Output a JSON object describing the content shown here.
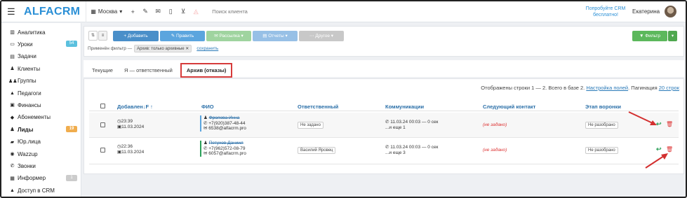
{
  "topbar": {
    "logo": "ALFACRM",
    "city": "Москва",
    "search_placeholder": "Поиск клиента",
    "promo": "Попробуйте CRM бесплатно!",
    "user": "Екатерина"
  },
  "sidebar": {
    "items": [
      {
        "label": "Аналитика",
        "icon": "chart-icon",
        "badge": ""
      },
      {
        "label": "Уроки",
        "icon": "lessons-icon",
        "badge": "54"
      },
      {
        "label": "Задачи",
        "icon": "tasks-icon",
        "badge": ""
      },
      {
        "label": "Клиенты",
        "icon": "user-icon",
        "badge": ""
      },
      {
        "label": "Группы",
        "icon": "users-icon",
        "badge": ""
      },
      {
        "label": "Педагоги",
        "icon": "graduation-icon",
        "badge": ""
      },
      {
        "label": "Финансы",
        "icon": "money-icon",
        "badge": ""
      },
      {
        "label": "Абонементы",
        "icon": "tag-icon",
        "badge": ""
      },
      {
        "label": "Лиды",
        "icon": "leads-icon",
        "badge": "19"
      },
      {
        "label": "Юр.лица",
        "icon": "briefcase-icon",
        "badge": ""
      },
      {
        "label": "Wazzup",
        "icon": "whatsapp-icon",
        "badge": ""
      },
      {
        "label": "Звонки",
        "icon": "phone-icon",
        "badge": ""
      },
      {
        "label": "Информер",
        "icon": "informer-icon",
        "badge": "1"
      },
      {
        "label": "Доступ в CRM",
        "icon": "lock-icon",
        "badge": ""
      }
    ],
    "colors": {
      "green": "#5bc0de",
      "orange": "#f0ad4e",
      "gray": "#ccc"
    }
  },
  "toolbar": {
    "add": "+ Добавить",
    "edit": "✎ Править",
    "mailing": "✉ Рассылка ▾",
    "reports": "▤ Отчеты ▾",
    "other": "⋯ Другое ▾",
    "filter": "▼ Фильтр",
    "applied_label": "Применён фильтр —",
    "applied_chip": "Архив: только архивные",
    "save": "сохранить"
  },
  "tabs": [
    "Текущие",
    "Я — ответственный",
    "Архив (отказы)"
  ],
  "table": {
    "info_prefix": "Отображены строки 1 — 2. Всего в базе 2.",
    "fields_link": "Настройка полей",
    "pagination_label": "Пагинация",
    "pagination_value": "20 строк",
    "headers": [
      "Добавлен↓F ↑",
      "ФИО",
      "Ответственный",
      "Коммуникации",
      "Следующий контакт",
      "Этап воронки"
    ],
    "rows": [
      {
        "time": "23:39",
        "date": "11.03.2024",
        "name": "Фролова Инна",
        "phone": "+7(920)387-48-44",
        "email": "6538@alfacrm.pro",
        "responsible": "Не задано",
        "comm1": "11.03.24 00:03 — 0 сек",
        "comm2": "...и еще 1",
        "next": "(не задано)",
        "stage": "Не разобрано"
      },
      {
        "time": "22:36",
        "date": "11.03.2024",
        "name": "Петухов Даниил",
        "phone": "+7(962)572-08-79",
        "email": "6057@alfacrm.pro",
        "responsible": "Василий Яровец",
        "comm1": "11.03.24 00:03 — 0 сек",
        "comm2": "...и еще 3",
        "next": "(не задано)",
        "stage": "Не разобрано"
      }
    ]
  }
}
